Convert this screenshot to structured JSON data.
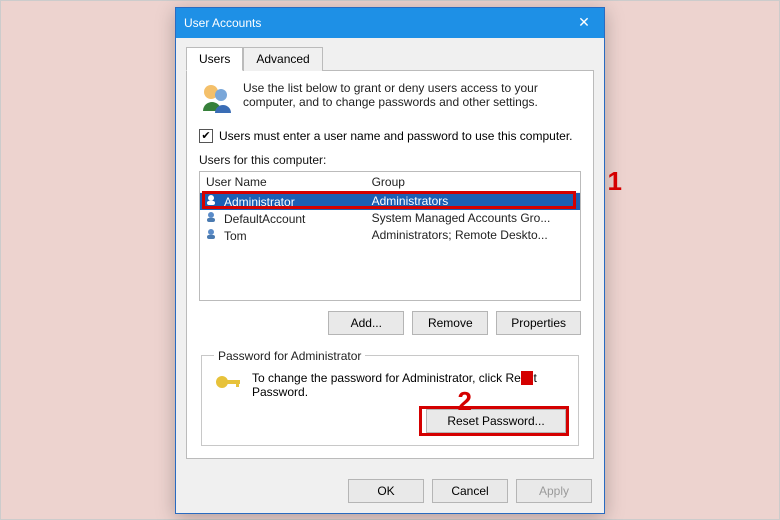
{
  "window": {
    "title": "User Accounts"
  },
  "tabs": {
    "users": "Users",
    "advanced": "Advanced"
  },
  "intro": "Use the list below to grant or deny users access to your computer, and to change passwords and other settings.",
  "checkbox": {
    "checked": true,
    "label": "Users must enter a user name and password to use this computer."
  },
  "list": {
    "caption": "Users for this computer:",
    "headers": {
      "username": "User Name",
      "group": "Group"
    },
    "rows": [
      {
        "name": "Administrator",
        "group": "Administrators",
        "selected": true
      },
      {
        "name": "DefaultAccount",
        "group": "System Managed Accounts Gro...",
        "selected": false
      },
      {
        "name": "Tom",
        "group": "Administrators; Remote Deskto...",
        "selected": false
      }
    ]
  },
  "buttons": {
    "add": "Add...",
    "remove": "Remove",
    "properties": "Properties",
    "ok": "OK",
    "cancel": "Cancel",
    "apply": "Apply",
    "reset": "Reset Password..."
  },
  "password_box": {
    "legend": "Password for Administrator",
    "text_before": "To change the password for Administrator, click Re",
    "text_after": "t Password."
  },
  "annotations": {
    "one": "1",
    "two": "2"
  },
  "colors": {
    "accent": "#1e90e6",
    "selection": "#1a5fb4",
    "annotation": "#d40000"
  }
}
